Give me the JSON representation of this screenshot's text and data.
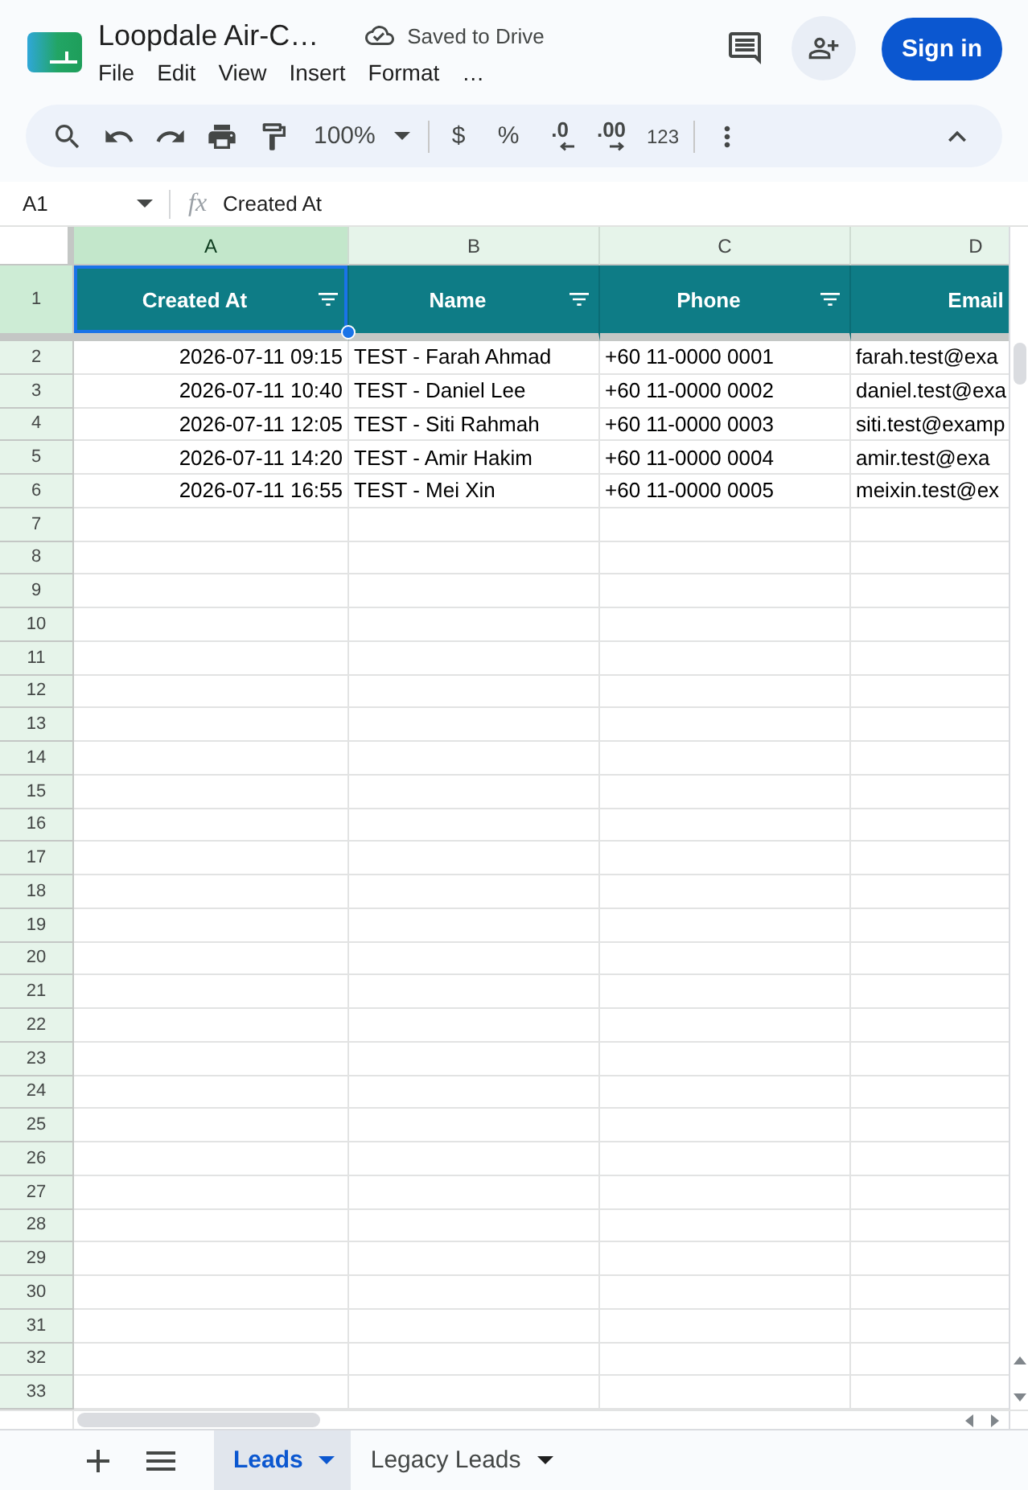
{
  "header": {
    "title": "Loopdale Air-C…",
    "save_status": "Saved to Drive",
    "menu": [
      "File",
      "Edit",
      "View",
      "Insert",
      "Format",
      "…"
    ],
    "sign_in": "Sign in"
  },
  "toolbar": {
    "zoom": "100%",
    "currency": "$",
    "percent": "%",
    "decrease_decimal": ".0",
    "increase_decimal": ".00",
    "number_format": "123"
  },
  "formula_bar": {
    "cell_ref": "A1",
    "function_label": "fx",
    "content": "Created At"
  },
  "sheet": {
    "columns": [
      {
        "letter": "A",
        "selected": true
      },
      {
        "letter": "B",
        "selected": false
      },
      {
        "letter": "C",
        "selected": false
      },
      {
        "letter": "D",
        "selected": false
      }
    ],
    "header_row": {
      "number": "1",
      "selected": true,
      "cells": [
        {
          "text": "Created At",
          "filter": true,
          "selected": true
        },
        {
          "text": "Name",
          "filter": true,
          "selected": false
        },
        {
          "text": "Phone",
          "filter": true,
          "selected": false
        },
        {
          "text": "Email",
          "filter": false,
          "selected": false
        }
      ]
    },
    "rows": [
      {
        "number": "2",
        "selected": false,
        "cells": [
          "2026-07-11 09:15",
          "TEST - Farah Ahmad",
          "+60 11-0000 0001",
          "farah.test@exa"
        ]
      },
      {
        "number": "3",
        "selected": false,
        "cells": [
          "2026-07-11 10:40",
          "TEST - Daniel Lee",
          "+60 11-0000 0002",
          "daniel.test@exa"
        ]
      },
      {
        "number": "4",
        "selected": false,
        "cells": [
          "2026-07-11 12:05",
          "TEST - Siti Rahmah",
          "+60 11-0000 0003",
          "siti.test@examp"
        ]
      },
      {
        "number": "5",
        "selected": false,
        "cells": [
          "2026-07-11 14:20",
          "TEST - Amir Hakim",
          "+60 11-0000 0004",
          "amir.test@exa"
        ]
      },
      {
        "number": "6",
        "selected": false,
        "cells": [
          "2026-07-11 16:55",
          "TEST - Mei Xin",
          "+60 11-0000 0005",
          "meixin.test@ex"
        ]
      },
      {
        "number": "7",
        "selected": false
      },
      {
        "number": "8",
        "selected": false
      },
      {
        "number": "9",
        "selected": false
      },
      {
        "number": "10",
        "selected": false
      },
      {
        "number": "11",
        "selected": false
      },
      {
        "number": "12",
        "selected": false
      },
      {
        "number": "13",
        "selected": false
      },
      {
        "number": "14",
        "selected": false
      },
      {
        "number": "15",
        "selected": false
      },
      {
        "number": "16",
        "selected": false
      },
      {
        "number": "17",
        "selected": false
      },
      {
        "number": "18",
        "selected": false
      },
      {
        "number": "19",
        "selected": false
      },
      {
        "number": "20",
        "selected": false
      },
      {
        "number": "21",
        "selected": false
      },
      {
        "number": "22",
        "selected": false
      },
      {
        "number": "23",
        "selected": false
      },
      {
        "number": "24",
        "selected": false
      },
      {
        "number": "25",
        "selected": false
      },
      {
        "number": "26",
        "selected": false
      },
      {
        "number": "27",
        "selected": false
      },
      {
        "number": "28",
        "selected": false
      },
      {
        "number": "29",
        "selected": false
      },
      {
        "number": "30",
        "selected": false
      },
      {
        "number": "31",
        "selected": false
      },
      {
        "number": "32",
        "selected": false
      },
      {
        "number": "33",
        "selected": false
      }
    ]
  },
  "sheet_tabs": [
    {
      "label": "Leads",
      "selected": true
    },
    {
      "label": "Legacy Leads",
      "selected": false
    }
  ]
}
